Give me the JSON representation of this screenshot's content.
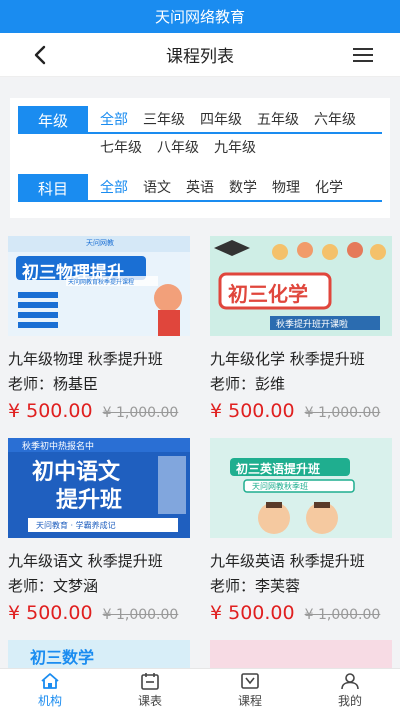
{
  "status_title": "天问网络教育",
  "nav": {
    "title": "课程列表"
  },
  "filters": {
    "grade_label": "年级",
    "grades": [
      "全部",
      "三年级",
      "四年级",
      "五年级",
      "六年级",
      "七年级",
      "八年级",
      "九年级"
    ],
    "subject_label": "科目",
    "subjects": [
      "全部",
      "语文",
      "英语",
      "数学",
      "物理",
      "化学"
    ]
  },
  "courses": [
    {
      "name": "九年级物理 秋季提升班",
      "teacher": "老师：杨基臣",
      "price": "¥ 500.00",
      "old_price": "¥ 1,000.00",
      "cover_lines": [
        "天问网教",
        "初三物理提升",
        "天问网教育秋季提升课程"
      ]
    },
    {
      "name": "九年级化学 秋季提升班",
      "teacher": "老师：彭维",
      "price": "¥ 500.00",
      "old_price": "¥ 1,000.00",
      "cover_lines": [
        "初三化学",
        "秋季提升班开课啦"
      ]
    },
    {
      "name": "九年级语文 秋季提升班",
      "teacher": "老师：文梦涵",
      "price": "¥ 500.00",
      "old_price": "¥ 1,000.00",
      "cover_lines": [
        "秋季初中热报名中",
        "初中语文",
        "提升班",
        "天问教育 · 学霸养成记"
      ]
    },
    {
      "name": "九年级英语 秋季提升班",
      "teacher": "老师：李芙蓉",
      "price": "¥ 500.00",
      "old_price": "¥ 1,000.00",
      "cover_lines": [
        "初三英语提升班",
        "天问网教秋季班"
      ]
    }
  ],
  "partial_covers": [
    "初三数学",
    ""
  ],
  "tabs": [
    {
      "label": "机构",
      "icon": "home-icon",
      "active": true
    },
    {
      "label": "课表",
      "icon": "calendar-icon",
      "active": false
    },
    {
      "label": "课程",
      "icon": "course-icon",
      "active": false
    },
    {
      "label": "我的",
      "icon": "user-icon",
      "active": false
    }
  ],
  "colors": {
    "accent": "#1a8cf0",
    "price": "#e02020"
  }
}
